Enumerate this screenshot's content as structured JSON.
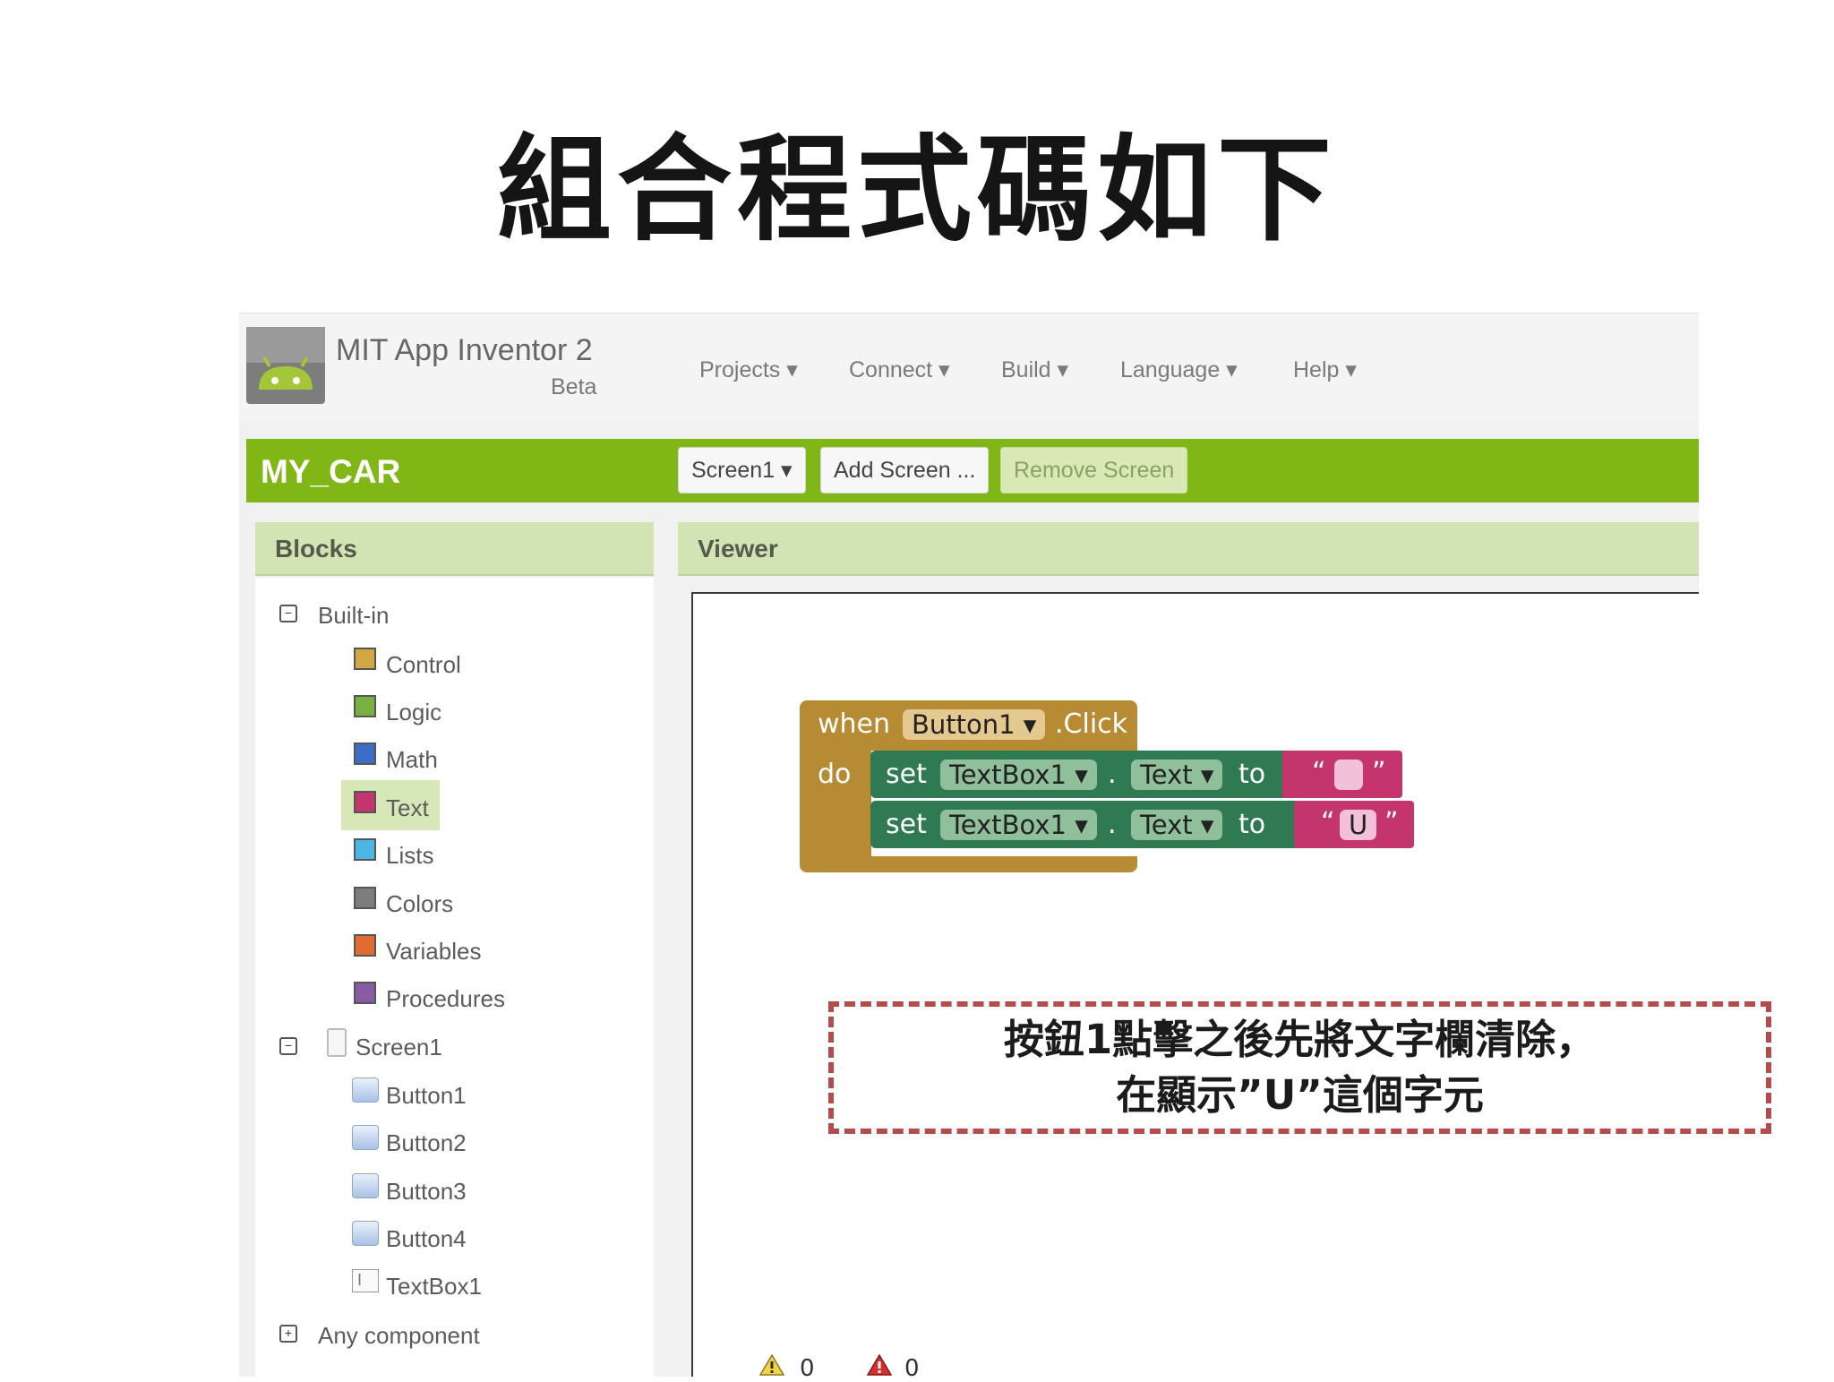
{
  "slide": {
    "title": "組合程式碼如下"
  },
  "app": {
    "name": "MIT App Inventor 2",
    "edition": "Beta",
    "menus": [
      "Projects ▾",
      "Connect ▾",
      "Build ▾",
      "Language ▾",
      "Help ▾"
    ]
  },
  "project": {
    "name": "MY_CAR",
    "screen_dropdown": "Screen1 ▾",
    "add_screen": "Add Screen ...",
    "remove_screen": "Remove Screen"
  },
  "blocks_panel": {
    "header": "Blocks",
    "builtin_label": "Built-in",
    "builtin": [
      {
        "label": "Control",
        "color": "#d3a746"
      },
      {
        "label": "Logic",
        "color": "#79b043"
      },
      {
        "label": "Math",
        "color": "#3d6ec6"
      },
      {
        "label": "Text",
        "color": "#c4356e"
      },
      {
        "label": "Lists",
        "color": "#4bb6e4"
      },
      {
        "label": "Colors",
        "color": "#7d7d7d"
      },
      {
        "label": "Variables",
        "color": "#e06b33"
      },
      {
        "label": "Procedures",
        "color": "#8a5ca6"
      }
    ],
    "selected": "Text",
    "screen_label": "Screen1",
    "components": [
      "Button1",
      "Button2",
      "Button3",
      "Button4",
      "TextBox1"
    ],
    "any_component": "Any component"
  },
  "viewer": {
    "header": "Viewer",
    "event_block": {
      "when": "when",
      "component": "Button1 ▾",
      "event": ".Click",
      "do": "do",
      "statements": [
        {
          "set": "set",
          "component": "TextBox1 ▾",
          "dot": ".",
          "property": "Text ▾",
          "to": "to",
          "open_quote": "“",
          "value": "",
          "close_quote": "”"
        },
        {
          "set": "set",
          "component": "TextBox1 ▾",
          "dot": ".",
          "property": "Text ▾",
          "to": "to",
          "open_quote": "“",
          "value": "U",
          "close_quote": "”"
        }
      ]
    },
    "warnings_count": "0",
    "errors_count": "0"
  },
  "annotation": {
    "line1": "按鈕1點擊之後先將文字欄清除，",
    "line2": "在顯示”U”這個字元"
  },
  "colors": {
    "accent_green": "#80b616",
    "event_block": "#b78b33",
    "set_block": "#2f7a52",
    "text_block": "#c4356e",
    "dash_border": "#b34c4c"
  }
}
